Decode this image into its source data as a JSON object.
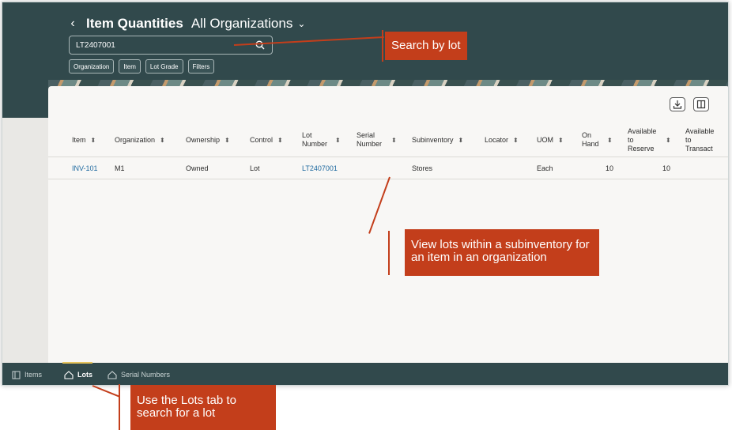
{
  "header": {
    "back_icon": "chevron-left-icon",
    "title": "Item Quantities",
    "subtitle": "All Organizations",
    "dropdown_icon": "chevron-down-icon"
  },
  "search": {
    "value": "LT2407001",
    "icon": "search-icon"
  },
  "filters": [
    "Organization",
    "Item",
    "Lot Grade",
    "Filters"
  ],
  "toolbar": {
    "download_icon": "download-icon",
    "columns_icon": "columns-icon"
  },
  "table": {
    "columns": [
      "Item",
      "Organization",
      "Ownership",
      "Control",
      "Lot Number",
      "Serial Number",
      "Subinventory",
      "Locator",
      "UOM",
      "On Hand",
      "Available to Reserve",
      "Available to Transact"
    ],
    "rows": [
      {
        "item": "INV-101",
        "organization": "M1",
        "ownership": "Owned",
        "control": "Lot",
        "lot_number": "LT2407001",
        "serial_number": "",
        "subinventory": "Stores",
        "locator": "",
        "uom": "Each",
        "on_hand": "10",
        "available_to_reserve": "10",
        "available_to_transact": ""
      }
    ]
  },
  "bottom_tabs": [
    {
      "label": "Items",
      "icon": "panel-icon",
      "active": false
    },
    {
      "label": "Lots",
      "icon": "home-icon",
      "active": true
    },
    {
      "label": "Serial Numbers",
      "icon": "home-icon",
      "active": false
    }
  ],
  "callouts": {
    "search": "Search by lot",
    "subinventory": "View lots within a subinventory for an item in an organization",
    "lots_tab": "Use the Lots tab to search for a lot"
  },
  "colors": {
    "header": "#31494c",
    "callout": "#c33e1b",
    "link": "#1f6aa0",
    "active_tab": "#e6c35c"
  }
}
